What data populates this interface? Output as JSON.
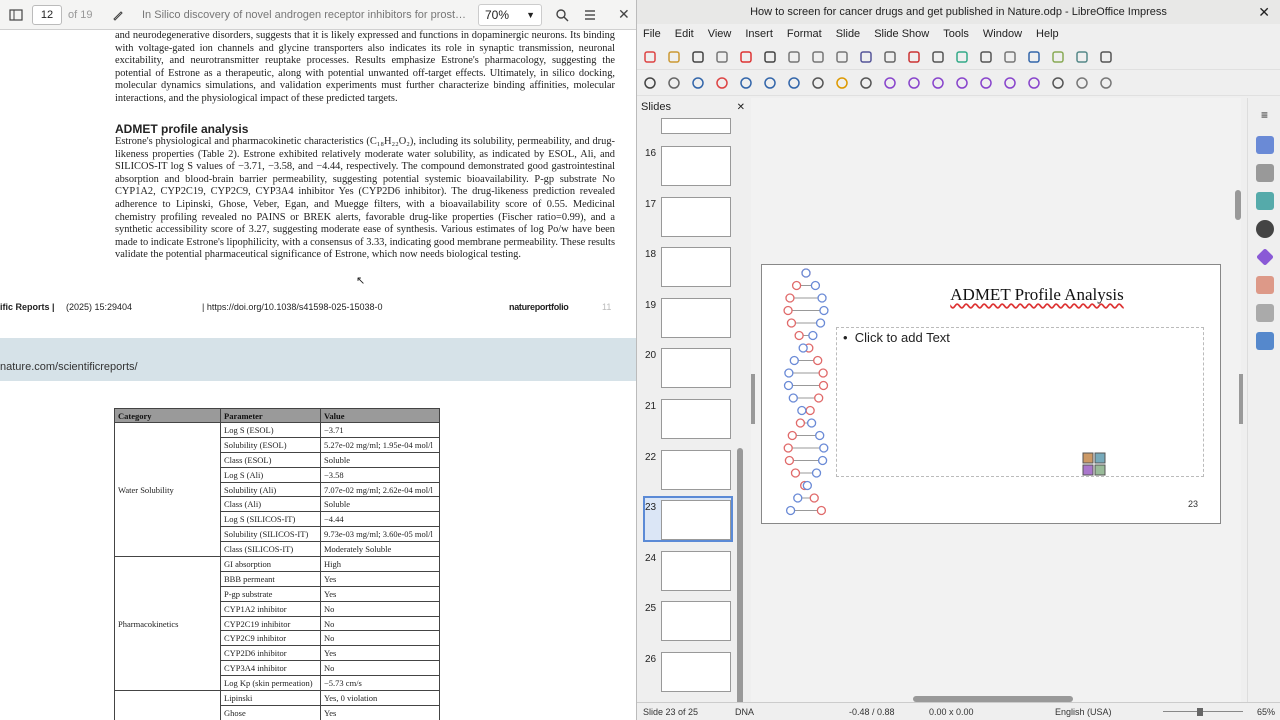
{
  "pdf": {
    "page_number": "12",
    "page_of": "of 19",
    "title": "In Silico discovery of novel androgen receptor inhibitors for prost…",
    "zoom": "70%",
    "para1": "and neurodegenerative disorders, suggests that it is likely expressed and functions in dopaminergic neurons. Its binding with voltage-gated ion channels and glycine transporters also indicates its role in synaptic transmission, neuronal excitability, and neurotransmitter reuptake processes. Results emphasize Estrone's pharmacology, suggesting the potential of Estrone as a therapeutic, along with potential unwanted off-target effects. Ultimately, in silico docking, molecular dynamics simulations, and validation experiments must further characterize binding affinities, molecular interactions, and the physiological impact of these predicted targets.",
    "section_heading": "ADMET profile analysis",
    "para2": "Estrone's physiological and pharmacokinetic characteristics (C₁₈H₂₂O₂), including its solubility, permeability, and drug-likeness properties (Table 2). Estrone exhibited relatively moderate water solubility, as indicated by ESOL, Ali, and SILICOS-IT log S values of −3.71, −3.58, and −4.44, respectively. The compound demonstrated good gastrointestinal absorption and blood-brain barrier permeability, suggesting potential systemic bioavailability. P-gp substrate No CYP1A2, CYP2C19, CYP2C9, CYP3A4 inhibitor Yes (CYP2D6 inhibitor). The drug-likeness prediction revealed adherence to Lipinski, Ghose, Veber, Egan, and Muegge filters, with a bioavailability score of 0.55. Medicinal chemistry profiling revealed no PAINS or BREK alerts, favorable drug-like properties (Fischer ratio=0.99), and a synthetic accessibility score of 3.27, suggesting moderate ease of synthesis. Various estimates of log Po/w have been made to indicate Estrone's lipophilicity, with a consensus of 3.33, indicating good membrane permeability. These results validate the potential pharmaceutical significance of Estrone, which now needs biological testing.",
    "footer_journal": "ific Reports |",
    "footer_citation": "(2025) 15:29404",
    "footer_doi": "| https://doi.org/10.1038/s41598-025-15038-0",
    "footer_brand": "natureportfolio",
    "footer_page": "11",
    "url_text": "nature.com/scientificreports/",
    "table": {
      "headers": [
        "Category",
        "Parameter",
        "Value"
      ],
      "groups": [
        {
          "category": "Water Solubility",
          "rows": [
            [
              "Log S (ESOL)",
              "−3.71"
            ],
            [
              "Solubility (ESOL)",
              "5.27e-02 mg/ml; 1.95e-04 mol/l"
            ],
            [
              "Class (ESOL)",
              "Soluble"
            ],
            [
              "Log S (Ali)",
              "−3.58"
            ],
            [
              "Solubility (Ali)",
              "7.07e-02 mg/ml; 2.62e-04 mol/l"
            ],
            [
              "Class (Ali)",
              "Soluble"
            ],
            [
              "Log S (SILICOS-IT)",
              "−4.44"
            ],
            [
              "Solubility (SILICOS-IT)",
              "9.73e-03 mg/ml; 3.60e-05 mol/l"
            ],
            [
              "Class (SILICOS-IT)",
              "Moderately Soluble"
            ]
          ]
        },
        {
          "category": "Pharmacokinetics",
          "rows": [
            [
              "GI absorption",
              "High"
            ],
            [
              "BBB permeant",
              "Yes"
            ],
            [
              "P-gp substrate",
              "Yes"
            ],
            [
              "CYP1A2 inhibitor",
              "No"
            ],
            [
              "CYP2C19 inhibitor",
              "No"
            ],
            [
              "CYP2C9 inhibitor",
              "No"
            ],
            [
              "CYP2D6 inhibitor",
              "Yes"
            ],
            [
              "CYP3A4 inhibitor",
              "No"
            ],
            [
              "Log Kp (skin permeation)",
              "−5.73 cm/s"
            ]
          ]
        },
        {
          "category": "",
          "rows": [
            [
              "Lipinski",
              "Yes, 0 violation"
            ],
            [
              "Ghose",
              "Yes"
            ]
          ]
        }
      ]
    }
  },
  "impress": {
    "window_title": "How to screen for cancer drugs and get published in Nature.odp - LibreOffice Impress",
    "menu": [
      "File",
      "Edit",
      "View",
      "Insert",
      "Format",
      "Slide",
      "Slide Show",
      "Tools",
      "Window",
      "Help"
    ],
    "slides_pane_title": "Slides",
    "thumb_numbers": [
      "16",
      "17",
      "18",
      "19",
      "20",
      "21",
      "22",
      "23",
      "24",
      "25",
      "26"
    ],
    "selected_slide": "23",
    "slide_title": "ADMET Profile Analysis",
    "placeholder_text": "Click to add Text",
    "slide_number": "23",
    "status": {
      "slide_info": "Slide 23 of 25",
      "layout": "DNA",
      "position": "-0.48 / 0.88",
      "size": "0.00 x 0.00",
      "language": "English (USA)",
      "zoom": "65%"
    }
  },
  "colors": {
    "accent": "#5b8ad6",
    "dna_red": "#e06a6a",
    "dna_blue": "#6a8ad6"
  }
}
